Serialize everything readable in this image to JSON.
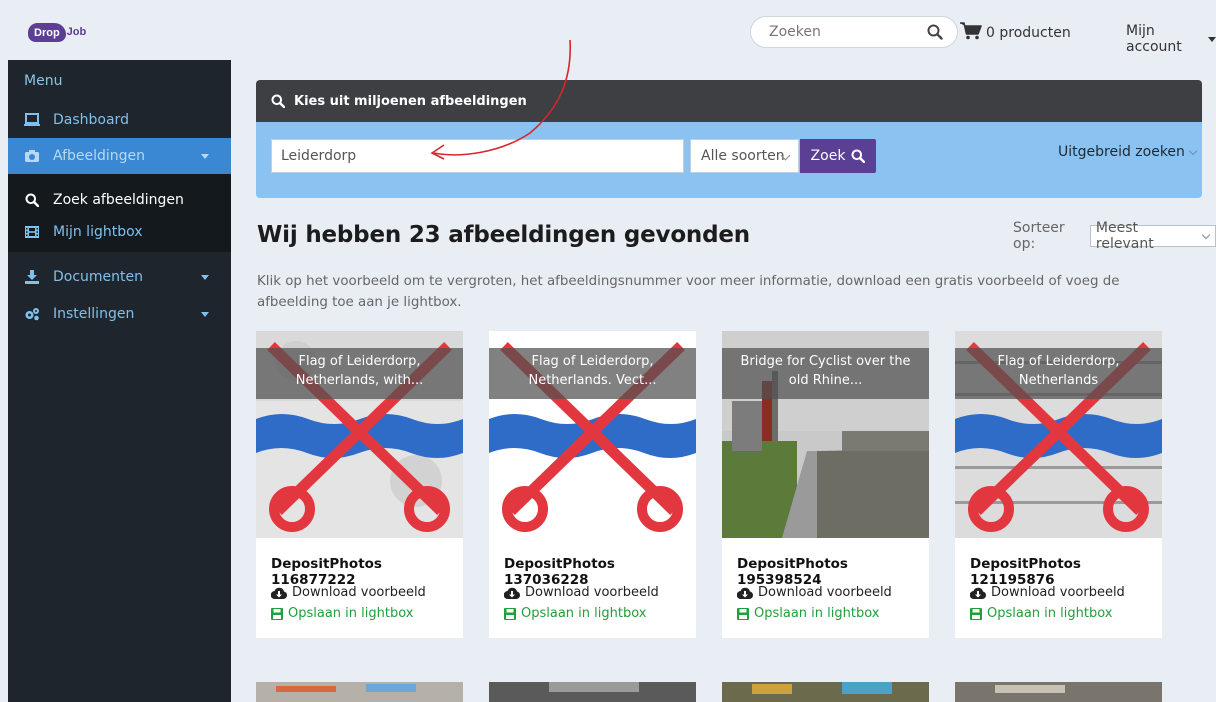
{
  "header": {
    "logo_drop": "Drop",
    "logo_job": "Job",
    "search_placeholder": "Zoeken",
    "cart_label": "0 producten",
    "account_label": "Mijn account"
  },
  "sidebar": {
    "menu_title": "Menu",
    "items": [
      {
        "label": "Dashboard",
        "icon": "laptop-icon"
      },
      {
        "label": "Afbeeldingen",
        "icon": "camera-icon"
      },
      {
        "label": "Documenten",
        "icon": "download-icon"
      },
      {
        "label": "Instellingen",
        "icon": "cogs-icon"
      }
    ],
    "sub_items": [
      {
        "label": "Zoek afbeeldingen",
        "icon": "search-icon"
      },
      {
        "label": "Mijn lightbox",
        "icon": "film-icon"
      }
    ]
  },
  "search_panel": {
    "title": "Kies uit miljoenen afbeeldingen",
    "query": "Leiderdorp",
    "type_select": "Alle soorten",
    "submit_label": "Zoek",
    "advanced_label": "Uitgebreid zoeken"
  },
  "results": {
    "title": "Wij hebben 23 afbeeldingen gevonden",
    "sort_label": "Sorteer op:",
    "sort_value": "Meest relevant",
    "intro": "Klik op het voorbeeld om te vergroten, het afbeeldingsnummer voor meer informatie, download een gratis voorbeeld of voeg de afbeelding toe aan je lightbox.",
    "cards": [
      {
        "caption": "Flag of Leiderdorp, Netherlands, with...",
        "number": "DepositPhotos 116877222",
        "download": "Download voorbeeld",
        "lightbox": "Opslaan in lightbox"
      },
      {
        "caption": "Flag of Leiderdorp, Netherlands. Vect...",
        "number": "DepositPhotos 137036228",
        "download": "Download voorbeeld",
        "lightbox": "Opslaan in lightbox"
      },
      {
        "caption": "Bridge for Cyclist over the old Rhine...",
        "number": "DepositPhotos 195398524",
        "download": "Download voorbeeld",
        "lightbox": "Opslaan in lightbox"
      },
      {
        "caption": "Flag of Leiderdorp, Netherlands",
        "number": "DepositPhotos 121195876",
        "download": "Download voorbeeld",
        "lightbox": "Opslaan in lightbox"
      }
    ]
  },
  "colors": {
    "brand": "#5a3f94",
    "sidebar_bg": "#1f252c",
    "sidebar_active": "#3a88d3",
    "panel_head": "#3d3f43",
    "panel_body": "#8ac2f2",
    "lightbox_green": "#20a03a",
    "annotation_red": "#d8262c"
  }
}
